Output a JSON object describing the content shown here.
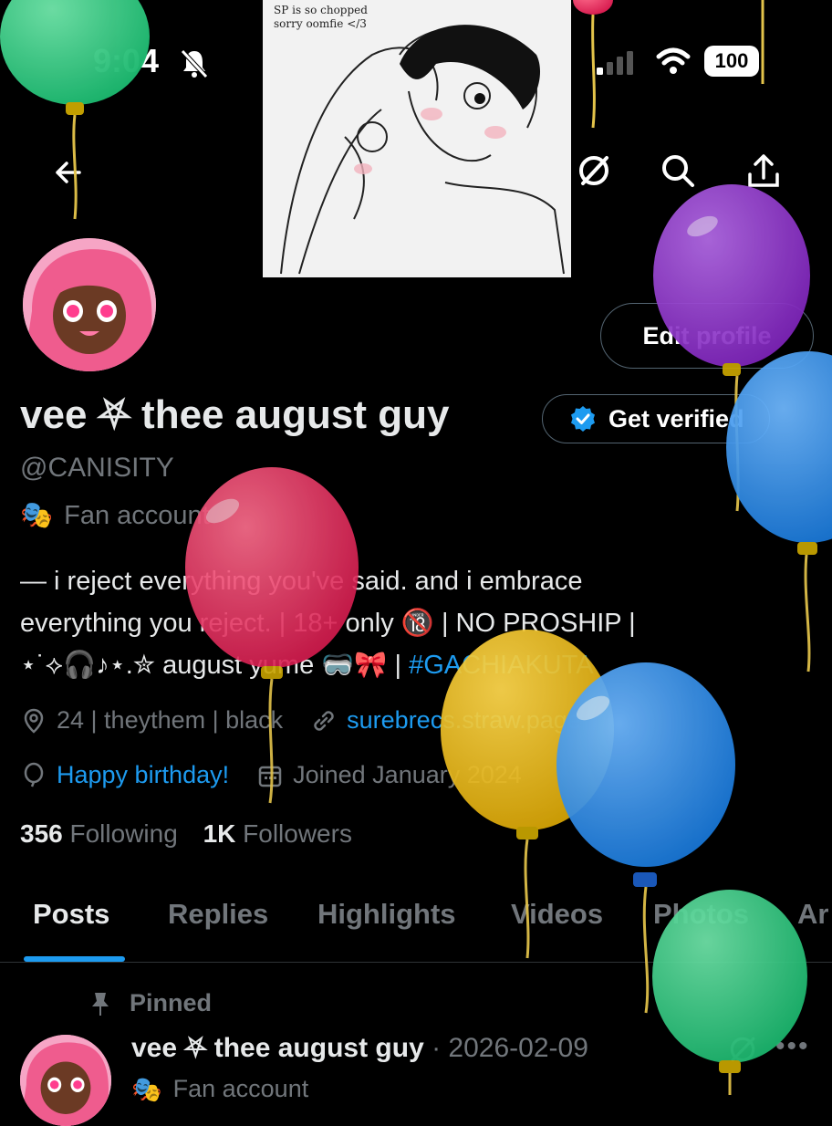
{
  "status_bar": {
    "time": "9:04",
    "battery": "100"
  },
  "banner": {
    "caption": "SP is so chopped\nsorry oomfie </3"
  },
  "profile": {
    "edit_button": "Edit profile",
    "display_name": "vee ⛧ thee august guy",
    "verify_button": "Get verified",
    "handle": "@CANISITY",
    "category_emoji": "🎭",
    "category": "Fan account",
    "bio_line1": "— i reject everything you've said. and i embrace",
    "bio_line2": "everything you reject. | 18+ only 🔞 | NO PROSHIP |",
    "bio_line3_text": "⋆˙⟡🎧♪⋆.✮ august yume 🥽🎀 | ",
    "bio_hashtag": "#GACHIAKUTA",
    "location": "24 | theythem | black",
    "website": "surebrecs.straw.page",
    "birthday": "Happy birthday!",
    "joined": "Joined January 2024",
    "following_count": "356",
    "following_label": "Following",
    "followers_count": "1K",
    "followers_label": "Followers"
  },
  "tabs": [
    "Posts",
    "Replies",
    "Highlights",
    "Videos",
    "Photos",
    "Ar"
  ],
  "post": {
    "pinned_label": "Pinned",
    "author": "vee ⛧ thee august guy",
    "date": "· 2026-02-09",
    "category_emoji": "🎭",
    "category": "Fan account",
    "more": "•••"
  },
  "colors": {
    "accent": "#1d9bf0",
    "background": "#000000",
    "muted": "#71767b"
  },
  "icons": [
    "back-arrow-icon",
    "grok-icon",
    "search-icon",
    "share-icon",
    "bell-slash-icon",
    "location-icon",
    "link-icon",
    "balloon-icon",
    "calendar-icon",
    "pin-icon",
    "verified-badge-icon"
  ]
}
